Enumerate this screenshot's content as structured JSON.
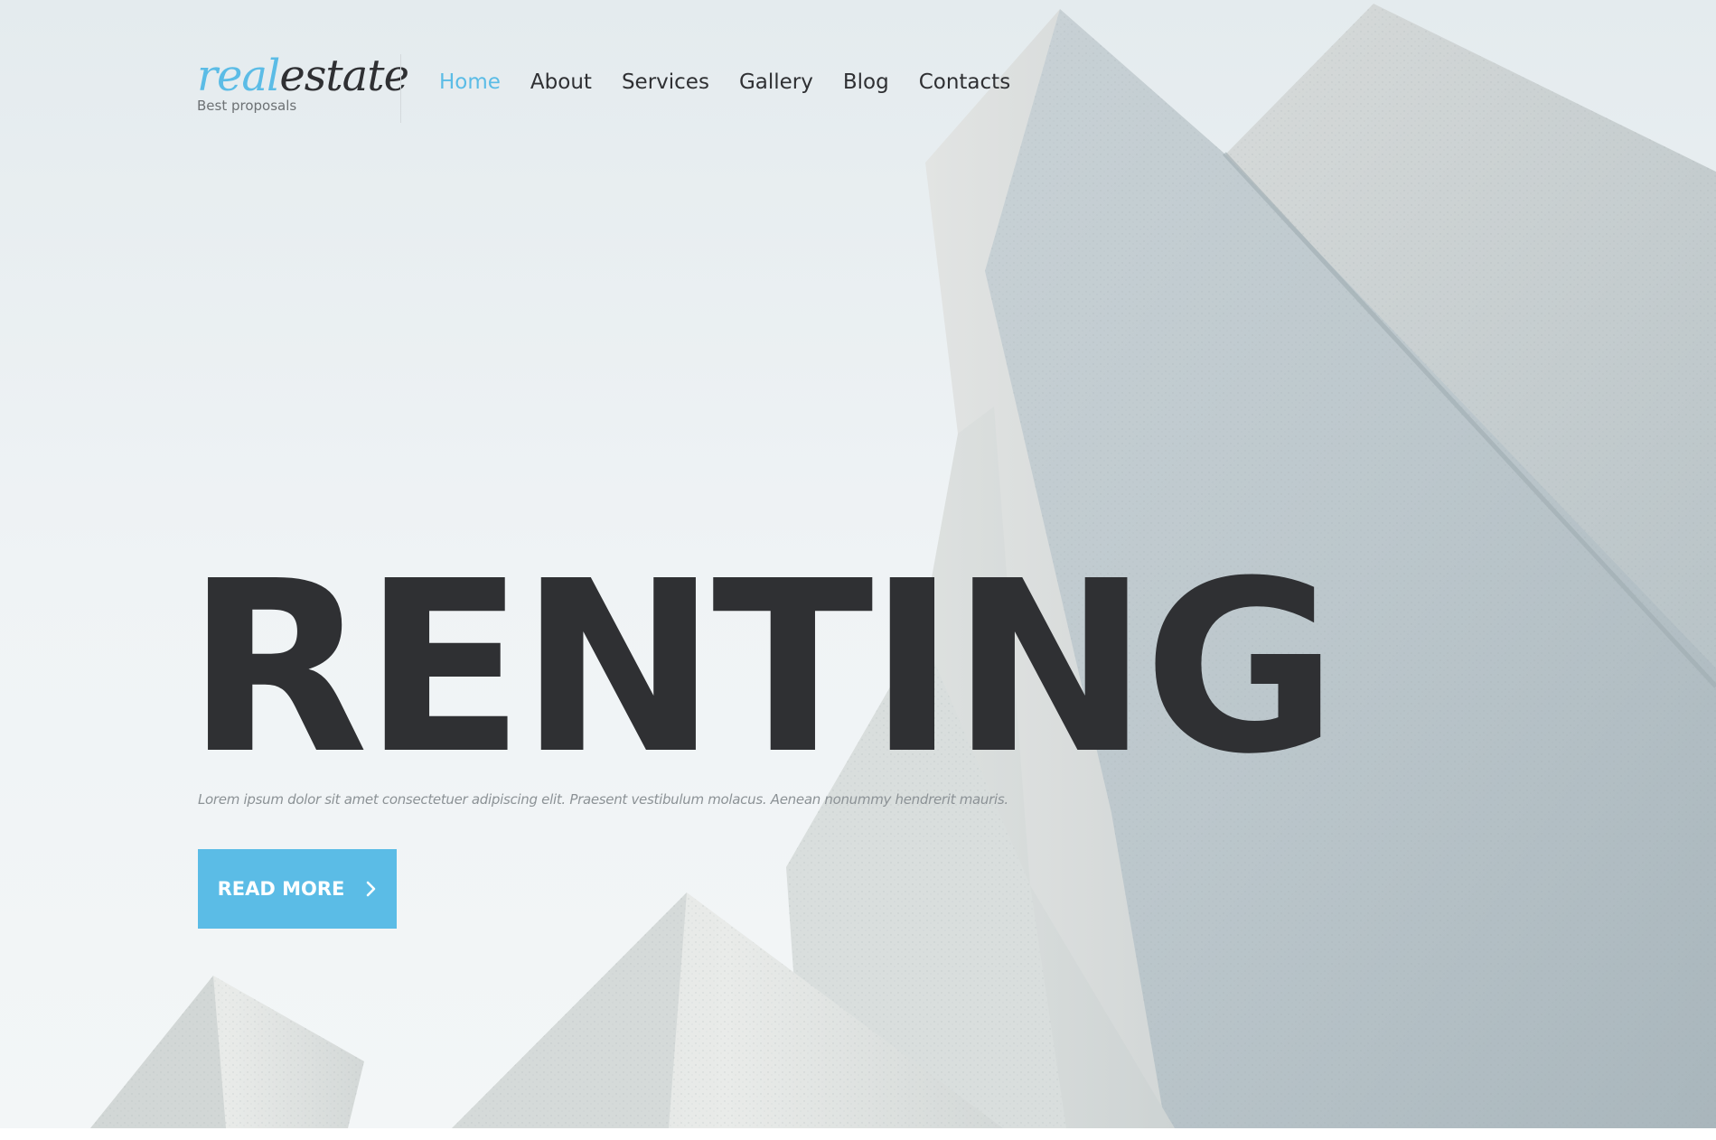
{
  "brand": {
    "logo_part1": "real",
    "logo_part2": "estate",
    "tagline": "Best proposals",
    "accent_color": "#5bbce6",
    "text_color": "#2f3033"
  },
  "nav": {
    "items": [
      {
        "label": "Home",
        "active": true
      },
      {
        "label": "About",
        "active": false
      },
      {
        "label": "Services",
        "active": false
      },
      {
        "label": "Gallery",
        "active": false
      },
      {
        "label": "Blog",
        "active": false
      },
      {
        "label": "Contacts",
        "active": false
      }
    ]
  },
  "hero": {
    "title": "RENTING",
    "description": "Lorem ipsum dolor sit amet consectetuer adipiscing elit. Praesent vestibulum molacus. Aenean nonummy hendrerit mauris.",
    "button_label": "READ MORE",
    "button_icon": "chevron-right-icon",
    "background": "concrete-blocks-image"
  }
}
